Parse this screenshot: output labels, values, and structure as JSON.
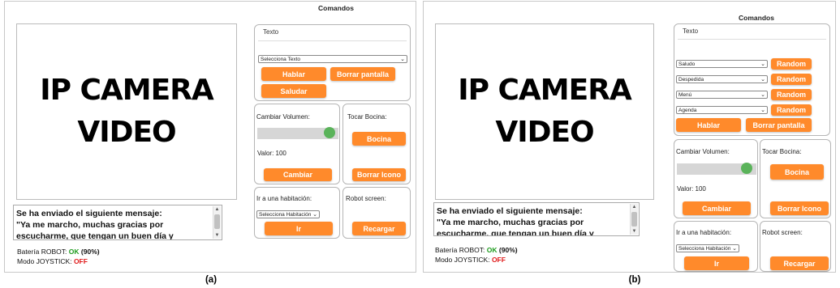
{
  "panel_a": {
    "camera_text": "IP CAMERA\nVIDEO",
    "message": "Se ha enviado el siguiente mensaje:\n\"Ya me marcho, muchas gracias por escucharme, que tengan un buen día y disfruten de los eventos. Nos vemos",
    "battery_label": "Batería ROBOT:",
    "battery_status": "OK",
    "battery_pct": "(90%)",
    "joystick_label": "Modo JOYSTICK:",
    "joystick_status": "OFF",
    "commands_title": "Comandos",
    "texto_title": "Texto",
    "texto_select": "Selecciona Texto",
    "hablar": "Hablar",
    "borrar_pantalla": "Borrar pantalla",
    "saludar": "Saludar",
    "volumen_title": "Cambiar Volumen:",
    "volumen_value": "Valor: 100",
    "volumen_level": 1.0,
    "cambiar": "Cambiar",
    "bocina_title": "Tocar Bocina:",
    "bocina": "Bocina",
    "borrar_icono": "Borrar Icono",
    "habitacion_title": "Ir a una habitación:",
    "habitacion_select": "Selecciona Habitación",
    "ir": "Ir",
    "robot_screen_title": "Robot screen:",
    "recargar": "Recargar",
    "caption": "(a)"
  },
  "panel_b": {
    "camera_text": "IP CAMERA\nVIDEO",
    "message": "Se ha enviado el siguiente mensaje:\n\"Ya me marcho, muchas gracias por escucharme, que tengan un buen día y disfruten de los eventos. Nos vemos",
    "battery_label": "Batería ROBOT:",
    "battery_status": "OK",
    "battery_pct": "(90%)",
    "joystick_label": "Modo JOYSTICK:",
    "joystick_status": "OFF",
    "commands_title": "Comandos",
    "texto_title": "Texto",
    "selects": [
      "Saludo",
      "Despedida",
      "Menú",
      "Agenda"
    ],
    "random": "Random",
    "hablar": "Hablar",
    "borrar_pantalla": "Borrar pantalla",
    "volumen_title": "Cambiar Volumen:",
    "volumen_value": "Valor: 100",
    "volumen_level": 1.0,
    "cambiar": "Cambiar",
    "bocina_title": "Tocar Bocina:",
    "bocina": "Bocina",
    "borrar_icono": "Borrar Icono",
    "habitacion_title": "Ir a una habitación:",
    "habitacion_select": "Selecciona Habitación",
    "ir": "Ir",
    "robot_screen_title": "Robot screen:",
    "recargar": "Recargar",
    "caption": "(b)"
  },
  "colors": {
    "accent": "#ff8a2b",
    "ok": "#1e9b1e",
    "off": "#e01b1b",
    "slider": "#5ab35a"
  }
}
